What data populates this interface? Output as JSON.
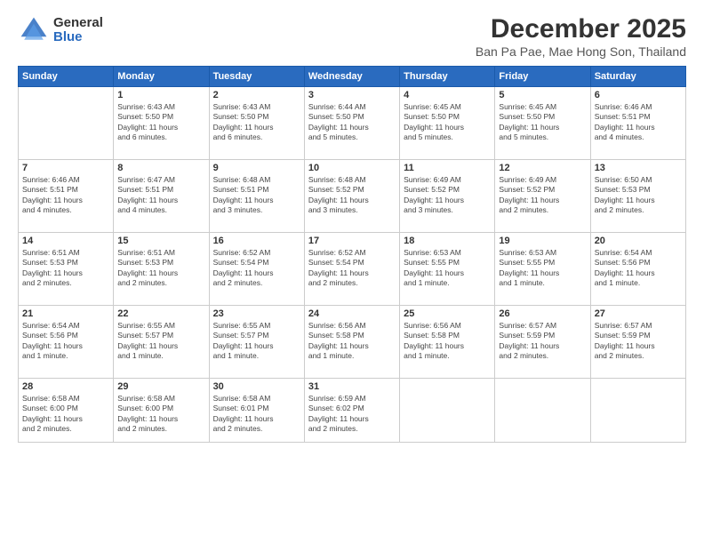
{
  "logo": {
    "general": "General",
    "blue": "Blue"
  },
  "header": {
    "month": "December 2025",
    "location": "Ban Pa Pae, Mae Hong Son, Thailand"
  },
  "days_header": [
    "Sunday",
    "Monday",
    "Tuesday",
    "Wednesday",
    "Thursday",
    "Friday",
    "Saturday"
  ],
  "weeks": [
    [
      {
        "day": "",
        "info": ""
      },
      {
        "day": "1",
        "info": "Sunrise: 6:43 AM\nSunset: 5:50 PM\nDaylight: 11 hours\nand 6 minutes."
      },
      {
        "day": "2",
        "info": "Sunrise: 6:43 AM\nSunset: 5:50 PM\nDaylight: 11 hours\nand 6 minutes."
      },
      {
        "day": "3",
        "info": "Sunrise: 6:44 AM\nSunset: 5:50 PM\nDaylight: 11 hours\nand 5 minutes."
      },
      {
        "day": "4",
        "info": "Sunrise: 6:45 AM\nSunset: 5:50 PM\nDaylight: 11 hours\nand 5 minutes."
      },
      {
        "day": "5",
        "info": "Sunrise: 6:45 AM\nSunset: 5:50 PM\nDaylight: 11 hours\nand 5 minutes."
      },
      {
        "day": "6",
        "info": "Sunrise: 6:46 AM\nSunset: 5:51 PM\nDaylight: 11 hours\nand 4 minutes."
      }
    ],
    [
      {
        "day": "7",
        "info": "Sunrise: 6:46 AM\nSunset: 5:51 PM\nDaylight: 11 hours\nand 4 minutes."
      },
      {
        "day": "8",
        "info": "Sunrise: 6:47 AM\nSunset: 5:51 PM\nDaylight: 11 hours\nand 4 minutes."
      },
      {
        "day": "9",
        "info": "Sunrise: 6:48 AM\nSunset: 5:51 PM\nDaylight: 11 hours\nand 3 minutes."
      },
      {
        "day": "10",
        "info": "Sunrise: 6:48 AM\nSunset: 5:52 PM\nDaylight: 11 hours\nand 3 minutes."
      },
      {
        "day": "11",
        "info": "Sunrise: 6:49 AM\nSunset: 5:52 PM\nDaylight: 11 hours\nand 3 minutes."
      },
      {
        "day": "12",
        "info": "Sunrise: 6:49 AM\nSunset: 5:52 PM\nDaylight: 11 hours\nand 2 minutes."
      },
      {
        "day": "13",
        "info": "Sunrise: 6:50 AM\nSunset: 5:53 PM\nDaylight: 11 hours\nand 2 minutes."
      }
    ],
    [
      {
        "day": "14",
        "info": "Sunrise: 6:51 AM\nSunset: 5:53 PM\nDaylight: 11 hours\nand 2 minutes."
      },
      {
        "day": "15",
        "info": "Sunrise: 6:51 AM\nSunset: 5:53 PM\nDaylight: 11 hours\nand 2 minutes."
      },
      {
        "day": "16",
        "info": "Sunrise: 6:52 AM\nSunset: 5:54 PM\nDaylight: 11 hours\nand 2 minutes."
      },
      {
        "day": "17",
        "info": "Sunrise: 6:52 AM\nSunset: 5:54 PM\nDaylight: 11 hours\nand 2 minutes."
      },
      {
        "day": "18",
        "info": "Sunrise: 6:53 AM\nSunset: 5:55 PM\nDaylight: 11 hours\nand 1 minute."
      },
      {
        "day": "19",
        "info": "Sunrise: 6:53 AM\nSunset: 5:55 PM\nDaylight: 11 hours\nand 1 minute."
      },
      {
        "day": "20",
        "info": "Sunrise: 6:54 AM\nSunset: 5:56 PM\nDaylight: 11 hours\nand 1 minute."
      }
    ],
    [
      {
        "day": "21",
        "info": "Sunrise: 6:54 AM\nSunset: 5:56 PM\nDaylight: 11 hours\nand 1 minute."
      },
      {
        "day": "22",
        "info": "Sunrise: 6:55 AM\nSunset: 5:57 PM\nDaylight: 11 hours\nand 1 minute."
      },
      {
        "day": "23",
        "info": "Sunrise: 6:55 AM\nSunset: 5:57 PM\nDaylight: 11 hours\nand 1 minute."
      },
      {
        "day": "24",
        "info": "Sunrise: 6:56 AM\nSunset: 5:58 PM\nDaylight: 11 hours\nand 1 minute."
      },
      {
        "day": "25",
        "info": "Sunrise: 6:56 AM\nSunset: 5:58 PM\nDaylight: 11 hours\nand 1 minute."
      },
      {
        "day": "26",
        "info": "Sunrise: 6:57 AM\nSunset: 5:59 PM\nDaylight: 11 hours\nand 2 minutes."
      },
      {
        "day": "27",
        "info": "Sunrise: 6:57 AM\nSunset: 5:59 PM\nDaylight: 11 hours\nand 2 minutes."
      }
    ],
    [
      {
        "day": "28",
        "info": "Sunrise: 6:58 AM\nSunset: 6:00 PM\nDaylight: 11 hours\nand 2 minutes."
      },
      {
        "day": "29",
        "info": "Sunrise: 6:58 AM\nSunset: 6:00 PM\nDaylight: 11 hours\nand 2 minutes."
      },
      {
        "day": "30",
        "info": "Sunrise: 6:58 AM\nSunset: 6:01 PM\nDaylight: 11 hours\nand 2 minutes."
      },
      {
        "day": "31",
        "info": "Sunrise: 6:59 AM\nSunset: 6:02 PM\nDaylight: 11 hours\nand 2 minutes."
      },
      {
        "day": "",
        "info": ""
      },
      {
        "day": "",
        "info": ""
      },
      {
        "day": "",
        "info": ""
      }
    ]
  ]
}
